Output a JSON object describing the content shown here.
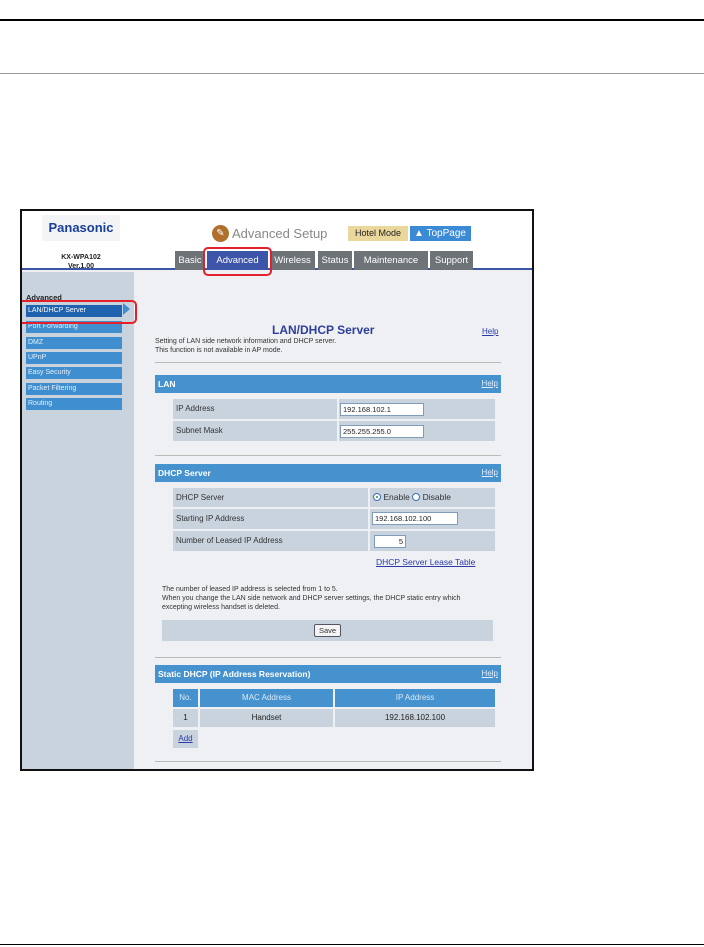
{
  "header": {
    "brand": "Panasonic",
    "model": "KX-WPA102",
    "version": "Ver.1.00",
    "title": "Advanced Setup",
    "hotel_mode": "Hotel Mode",
    "top_page": "TopPage"
  },
  "tabs": [
    "Basic",
    "Advanced",
    "Wireless",
    "Status",
    "Maintenance",
    "Support"
  ],
  "sidebar": {
    "heading": "Advanced",
    "items": [
      "LAN/DHCP Server",
      "Port Forwarding",
      "DMZ",
      "UPnP",
      "Easy Security",
      "Packet Filtering",
      "Routing"
    ]
  },
  "page": {
    "title": "LAN/DHCP Server",
    "help": "Help",
    "desc1": "Setting of LAN side network information and DHCP server.",
    "desc2": "This function is not available in AP mode."
  },
  "lan": {
    "title": "LAN",
    "help": "Help",
    "ip_label": "IP Address",
    "ip_value": "192.168.102.1",
    "mask_label": "Subnet Mask",
    "mask_value": "255.255.255.0"
  },
  "dhcp": {
    "title": "DHCP Server",
    "help": "Help",
    "server_label": "DHCP  Server",
    "enable": "Enable",
    "disable": "Disable",
    "start_label": "Starting IP Address",
    "start_value": "192.168.102.100",
    "count_label": "Number of Leased IP Address",
    "count_value": "5",
    "lease_link": "DHCP Server Lease Table",
    "note1": "The number of leased IP address is selected from 1 to 5.",
    "note2": "When you change the LAN side network and DHCP server settings, the DHCP static entry which",
    "note3": "excepting wireless handset is deleted.",
    "save": "Save"
  },
  "static": {
    "title": "Static DHCP (IP Address Reservation)",
    "help": "Help",
    "headers": [
      "No.",
      "MAC Address",
      "IP Address"
    ],
    "rows": [
      {
        "no": "1",
        "mac": "Handset",
        "ip": "192.168.102.100"
      }
    ],
    "add": "Add"
  }
}
